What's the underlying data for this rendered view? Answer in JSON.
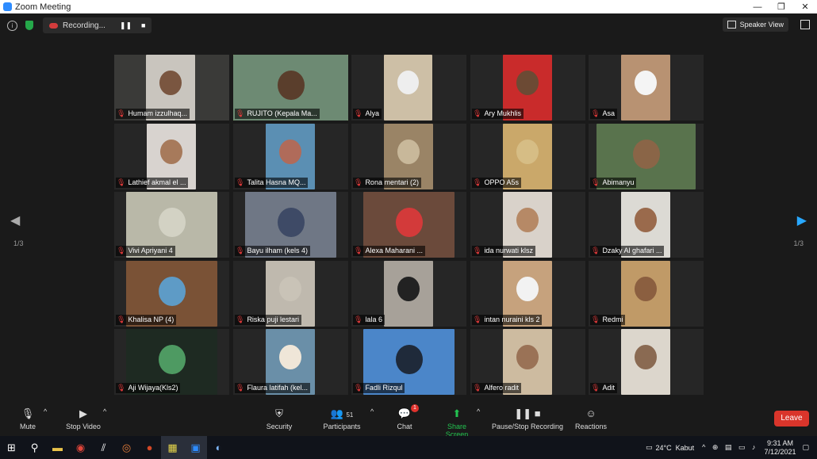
{
  "window": {
    "title": "Zoom Meeting",
    "minimize": "—",
    "restore": "❐",
    "close": "✕"
  },
  "topbar": {
    "recording_label": "Recording...",
    "pause": "❚❚",
    "stop": "■",
    "speaker_view": "Speaker View",
    "info": "i"
  },
  "nav": {
    "page_left": "1/3",
    "page_right": "1/3",
    "prev": "◀",
    "next": "▶"
  },
  "participants": [
    {
      "name": "Humam izzulhaq...",
      "bg": "#3a3a38",
      "vid": "#c9c5be",
      "face": "#7a5640",
      "vx": 40,
      "vw": 62
    },
    {
      "name": "RUJITO (Kepala Ma...",
      "bg": "#5f7f6a",
      "vid": "#6d8a73",
      "face": "#5a3e2c",
      "vx": 0,
      "vw": 145,
      "active": true
    },
    {
      "name": "Alya",
      "bg": "#262626",
      "vid": "#cdbfa6",
      "face": "#eee",
      "vx": 41,
      "vw": 61
    },
    {
      "name": "Ary Mukhlis",
      "bg": "#262626",
      "vid": "#c92b2b",
      "face": "#6c4a34",
      "vx": 41,
      "vw": 62
    },
    {
      "name": "Asa",
      "bg": "#262626",
      "vid": "#b89272",
      "face": "#f4f4f4",
      "vx": 41,
      "vw": 62
    },
    {
      "name": "Lathief akmal el ...",
      "bg": "#262626",
      "vid": "#d8d3cf",
      "face": "#a77a5b",
      "vx": 41,
      "vw": 62
    },
    {
      "name": "Talita Hasna MQ...",
      "bg": "#262626",
      "vid": "#5b8fb3",
      "face": "#b06b5a",
      "vx": 41,
      "vw": 62
    },
    {
      "name": "Rona mentari (2)",
      "bg": "#262626",
      "vid": "#9a8466",
      "face": "#c8b89a",
      "vx": 41,
      "vw": 62
    },
    {
      "name": "OPPO A5s",
      "bg": "#262626",
      "vid": "#caa86a",
      "face": "#d6bd85",
      "vx": 41,
      "vw": 62
    },
    {
      "name": "Abimanyu",
      "bg": "#262626",
      "vid": "#59734d",
      "face": "#8a6547",
      "vx": 10,
      "vw": 125
    },
    {
      "name": "Vivi Apriyani 4",
      "bg": "#262626",
      "vid": "#b9b8a8",
      "face": "#d3d2c4",
      "vx": 15,
      "vw": 115
    },
    {
      "name": "Bayu ilham (kels 4)",
      "bg": "#262626",
      "vid": "#6f7785",
      "face": "#3e4a66",
      "vx": 15,
      "vw": 115
    },
    {
      "name": "Alexa Maharani ...",
      "bg": "#262626",
      "vid": "#6b4a3b",
      "face": "#d33a3a",
      "vx": 15,
      "vw": 115
    },
    {
      "name": "ida nurwati klsz",
      "bg": "#262626",
      "vid": "#d9d2ca",
      "face": "#b68966",
      "vx": 41,
      "vw": 62
    },
    {
      "name": "Dzaky Al ghafari ...",
      "bg": "#262626",
      "vid": "#dcdad4",
      "face": "#9a6a4c",
      "vx": 41,
      "vw": 62
    },
    {
      "name": "Khalisa NP (4)",
      "bg": "#262626",
      "vid": "#7a5236",
      "face": "#5e9bc6",
      "vx": 15,
      "vw": 115
    },
    {
      "name": "Riska puji lestari",
      "bg": "#262626",
      "vid": "#bfb9ae",
      "face": "#c9c3b7",
      "vx": 41,
      "vw": 62
    },
    {
      "name": "lala 6",
      "bg": "#262626",
      "vid": "#a7a199",
      "face": "#222",
      "vx": 41,
      "vw": 62
    },
    {
      "name": "intan nuraini kls 2",
      "bg": "#262626",
      "vid": "#c6a27d",
      "face": "#f2f2f2",
      "vx": 41,
      "vw": 62
    },
    {
      "name": "Redmi",
      "bg": "#262626",
      "vid": "#c09a67",
      "face": "#8b5f40",
      "vx": 41,
      "vw": 62
    },
    {
      "name": "Aji Wijaya(Kls2)",
      "bg": "#262626",
      "vid": "#1e2a22",
      "face": "#4e9a62",
      "vx": 15,
      "vw": 115
    },
    {
      "name": "Flaura latifah (kel...",
      "bg": "#262626",
      "vid": "#6a8fa8",
      "face": "#efe6d8",
      "vx": 41,
      "vw": 62
    },
    {
      "name": "Fadli Rizqul",
      "bg": "#262626",
      "vid": "#4b86c9",
      "face": "#1f2a3a",
      "vx": 15,
      "vw": 115
    },
    {
      "name": "Alfero radit",
      "bg": "#262626",
      "vid": "#cdbba0",
      "face": "#9a7256",
      "vx": 41,
      "vw": 62
    },
    {
      "name": "Adit",
      "bg": "#262626",
      "vid": "#dcd6cc",
      "face": "#8a6a52",
      "vx": 41,
      "vw": 62
    }
  ],
  "toolbar": {
    "mute": "Mute",
    "stop_video": "Stop Video",
    "security": "Security",
    "participants": "Participants",
    "participants_count": "51",
    "chat": "Chat",
    "chat_badge": "1",
    "share_screen": "Share Screen",
    "pause_stop_recording": "Pause/Stop Recording",
    "reactions": "Reactions",
    "leave": "Leave"
  },
  "taskbar": {
    "temperature": "24°C",
    "weather": "Kabut",
    "time": "9:31 AM",
    "date": "7/12/2021"
  }
}
